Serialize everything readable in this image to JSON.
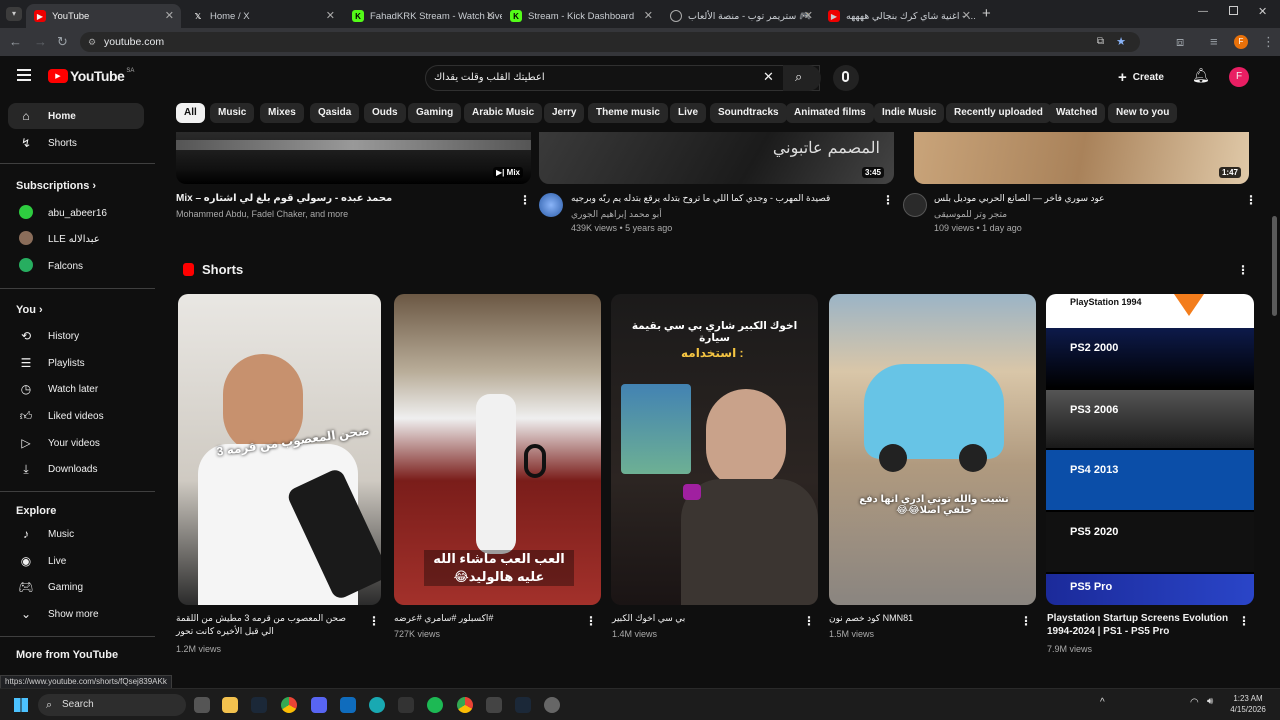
{
  "browser": {
    "tabs": [
      {
        "title": "YouTube",
        "active": true,
        "fav": "yt"
      },
      {
        "title": "Home / X",
        "active": false,
        "fav": "x"
      },
      {
        "title": "FahadKRK Stream - Watch Live",
        "active": false,
        "fav": "k"
      },
      {
        "title": "Stream - Kick Dashboard",
        "active": false,
        "fav": "k"
      },
      {
        "title": "ستريمر توب - منصة الألعاب 🎮",
        "active": false,
        "fav": "g"
      },
      {
        "title": "اغنية شاي كرك بنجالي ههههه - ...",
        "active": false,
        "fav": "yt"
      }
    ],
    "url": "youtube.com",
    "status_url": "https://www.youtube.com/shorts/fQsej839AKk"
  },
  "header": {
    "logo": "YouTube",
    "region": "SA",
    "search_value": "اعطيتك القلب وقلت يقداك",
    "create_label": "Create",
    "avatar_letter": "F"
  },
  "chips": [
    "All",
    "Music",
    "Mixes",
    "Qasida",
    "Ouds",
    "Gaming",
    "Arabic Music",
    "Jerry",
    "Theme music",
    "Live",
    "Soundtracks",
    "Animated films",
    "Indie Music",
    "Recently uploaded",
    "Watched",
    "New to you"
  ],
  "sidebar": {
    "main": [
      {
        "label": "Home",
        "icon": "home-icon"
      },
      {
        "label": "Shorts",
        "icon": "shorts-icon"
      }
    ],
    "subs_header": "Subscriptions",
    "subs": [
      {
        "label": "abu_abeer16",
        "color": "#2ecc40"
      },
      {
        "label": "LLE عبدالاله",
        "color": "#8a6d5a"
      },
      {
        "label": "Falcons",
        "color": "#27ae60"
      }
    ],
    "you_header": "You",
    "you": [
      {
        "label": "History",
        "icon": "history-icon"
      },
      {
        "label": "Playlists",
        "icon": "playlists-icon"
      },
      {
        "label": "Watch later",
        "icon": "watch-later-icon"
      },
      {
        "label": "Liked videos",
        "icon": "like-icon"
      },
      {
        "label": "Your videos",
        "icon": "your-videos-icon"
      },
      {
        "label": "Downloads",
        "icon": "download-icon"
      }
    ],
    "explore_header": "Explore",
    "explore": [
      {
        "label": "Music",
        "icon": "music-icon"
      },
      {
        "label": "Live",
        "icon": "live-icon"
      },
      {
        "label": "Gaming",
        "icon": "gaming-icon"
      },
      {
        "label": "Show more",
        "icon": "chevron-down-icon"
      }
    ],
    "more_header": "More from YouTube"
  },
  "top_videos": [
    {
      "title": "Mix – محمد عبده - رسولي قوم بلغ لي اشتاره",
      "meta": "Mohammed Abdu, Fadel Chaker, and more",
      "badge": "Mix",
      "views": ""
    },
    {
      "title": "قصيدة المهرب - وجدي كما اللي ما تروح بتدله يرقع بتدله يم ربّه وبرجيه",
      "channel": "أبو محمد إبراهيم الجوري",
      "views": "439K views • 5 years ago",
      "badge": "3:45"
    },
    {
      "title": "عود سوري فاخر — الصانع الحربي موديل بلس",
      "channel": "متجر وتر للموسيقى",
      "views": "109 views • 1 day ago",
      "badge": "1:47"
    }
  ],
  "shorts_header": "Shorts",
  "shorts": [
    {
      "title": "صحن المعصوب من قرمه 3 مطيش من اللقمة الي قبل الأخيره كانت تحور",
      "views": "1.2M views",
      "overlay": "صحن المعصوب من قرمه 3"
    },
    {
      "title": "#اكسبلور #سامري #عرضه",
      "views": "727K views",
      "overlay": "العب العب ماشاء الله عليه هالوليد😂"
    },
    {
      "title": "بي سي اخوك الكبير",
      "views": "1.4M views",
      "overlay": "اخوك الكبير شاري بي سي بقيمة سيارة"
    },
    {
      "title": "NMN81 كود خصم نون",
      "views": "1.5M views",
      "overlay": "نشيت والله توني ادري انها دفع خلفي اصلا😂😂"
    },
    {
      "title": "Playstation Startup Screens Evolution 1994-2024 | PS1 - PS5 Pro",
      "views": "7.9M views",
      "overlay": ""
    }
  ],
  "ps_labels": [
    "PlayStation 1994",
    "PS2 2000",
    "PS3 2006",
    "PS4 2013",
    "PS5 2020",
    "PS5 Pro"
  ],
  "taskbar": {
    "search": "Search",
    "time": "1:23 AM",
    "date": "4/15/2026"
  }
}
